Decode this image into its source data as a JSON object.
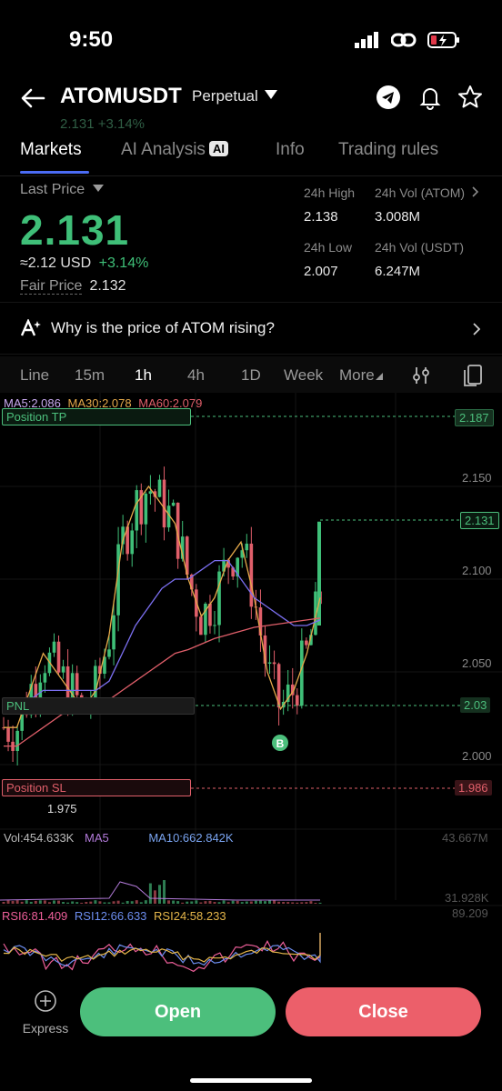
{
  "status": {
    "time": "9:50"
  },
  "header": {
    "pair": "ATOMUSDT",
    "type": "Perpetual",
    "ghost_price": "2.131 +3.14%"
  },
  "tabs": [
    {
      "label": "Markets"
    },
    {
      "label": "AI Analysis",
      "badge": "AI"
    },
    {
      "label": "Info"
    },
    {
      "label": "Trading rules"
    }
  ],
  "price": {
    "label": "Last Price",
    "last": "2.131",
    "approx": "≈2.12",
    "currency": "USD",
    "change": "+3.14%",
    "fair_label": "Fair Price",
    "fair_value": "2.132",
    "up_color": "#3fbf78"
  },
  "stats": {
    "high_label": "24h High",
    "high": "2.138",
    "vol_atom_label": "24h Vol (ATOM)",
    "vol_atom": "3.008M",
    "low_label": "24h Low",
    "low": "2.007",
    "vol_usdt_label": "24h Vol (USDT)",
    "vol_usdt": "6.247M"
  },
  "ai_banner": {
    "text": "Why is the price of ATOM rising?"
  },
  "intervals": [
    "Line",
    "15m",
    "1h",
    "4h",
    "1D",
    "Week",
    "More"
  ],
  "active_interval": "1h",
  "chart": {
    "ma_legend": {
      "ma5": "MA5:2.086",
      "ma30": "MA30:2.078",
      "ma60": "MA60:2.079"
    },
    "position_tp_label": "Position TP",
    "position_tp_price": "2.187",
    "current_price_tag": "2.131",
    "pnl_label": "PNL",
    "pnl_price": "2.03",
    "position_sl_label": "Position SL",
    "position_sl_price": "1.986",
    "low_marker": "1.975",
    "y_axis": [
      "2.150",
      "2.100",
      "2.050",
      "2.000"
    ],
    "buy_marker": "B",
    "volume": {
      "vol": "Vol:454.633K",
      "ma5": "MA5",
      "ma10": "MA10:662.842K",
      "max": "43.667M",
      "min": "31.928K"
    },
    "rsi": {
      "rsi6": "RSI6:81.409",
      "rsi12": "RSI12:66.633",
      "rsi24": "RSI24:58.233",
      "max": "89.209"
    }
  },
  "chart_data": {
    "type": "line",
    "title": "",
    "series": [
      {
        "name": "MA5",
        "color": "#e5a94a",
        "values": [
          2.02,
          2.02,
          2.04,
          2.06,
          2.05,
          2.04,
          2.03,
          2.04,
          2.07,
          2.12,
          2.14,
          2.15,
          2.14,
          2.13,
          2.1,
          2.08,
          2.09,
          2.11,
          2.12,
          2.09,
          2.05,
          2.03,
          2.04,
          2.06,
          2.09
        ]
      },
      {
        "name": "MA30",
        "color": "#7b6ff0",
        "values": [
          2.03,
          2.03,
          2.035,
          2.04,
          2.04,
          2.04,
          2.04,
          2.04,
          2.045,
          2.06,
          2.075,
          2.085,
          2.095,
          2.1,
          2.1,
          2.105,
          2.11,
          2.11,
          2.1,
          2.09,
          2.085,
          2.08,
          2.075,
          2.075,
          2.078
        ]
      },
      {
        "name": "MA60",
        "color": "#e05f6a",
        "values": [
          2.01,
          2.01,
          2.015,
          2.02,
          2.025,
          2.03,
          2.03,
          2.035,
          2.035,
          2.04,
          2.045,
          2.05,
          2.055,
          2.06,
          2.062,
          2.065,
          2.068,
          2.07,
          2.072,
          2.074,
          2.075,
          2.076,
          2.077,
          2.078,
          2.079
        ]
      }
    ],
    "ylim": [
      1.98,
      2.19
    ]
  },
  "buttons": {
    "express": "Express",
    "open": "Open",
    "close": "Close"
  }
}
